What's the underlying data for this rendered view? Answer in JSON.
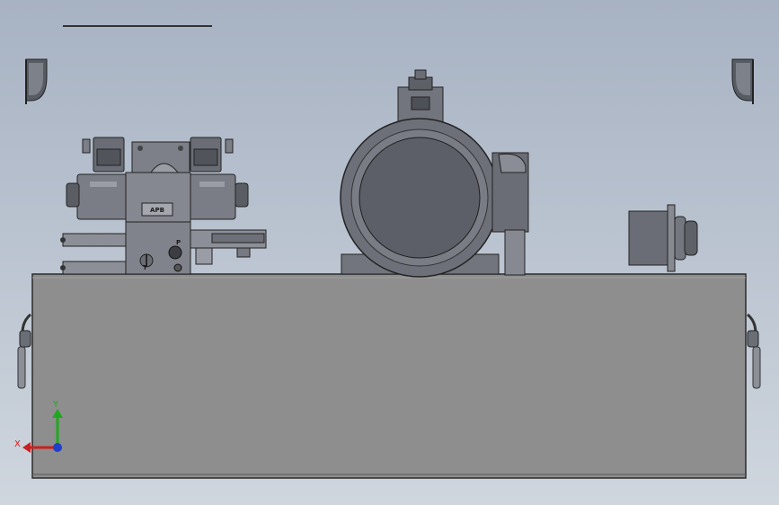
{
  "viewport": {
    "background_top": "#a7b2c3",
    "background_bottom": "#cfd6de"
  },
  "valve_block": {
    "brand_label": "APB",
    "port_p_label": "P",
    "port_t_label": "T"
  },
  "triad": {
    "x_label": "X",
    "y_label": "Y",
    "x_color": "#cc1f1f",
    "y_color": "#1fa81f",
    "z_color": "#1f3fcc"
  },
  "model_colors": {
    "tank": "#8e8e8e",
    "tank_edge": "#2b2b2b",
    "motor": "#6e7079",
    "motor_face": "#5d5f68"
  }
}
